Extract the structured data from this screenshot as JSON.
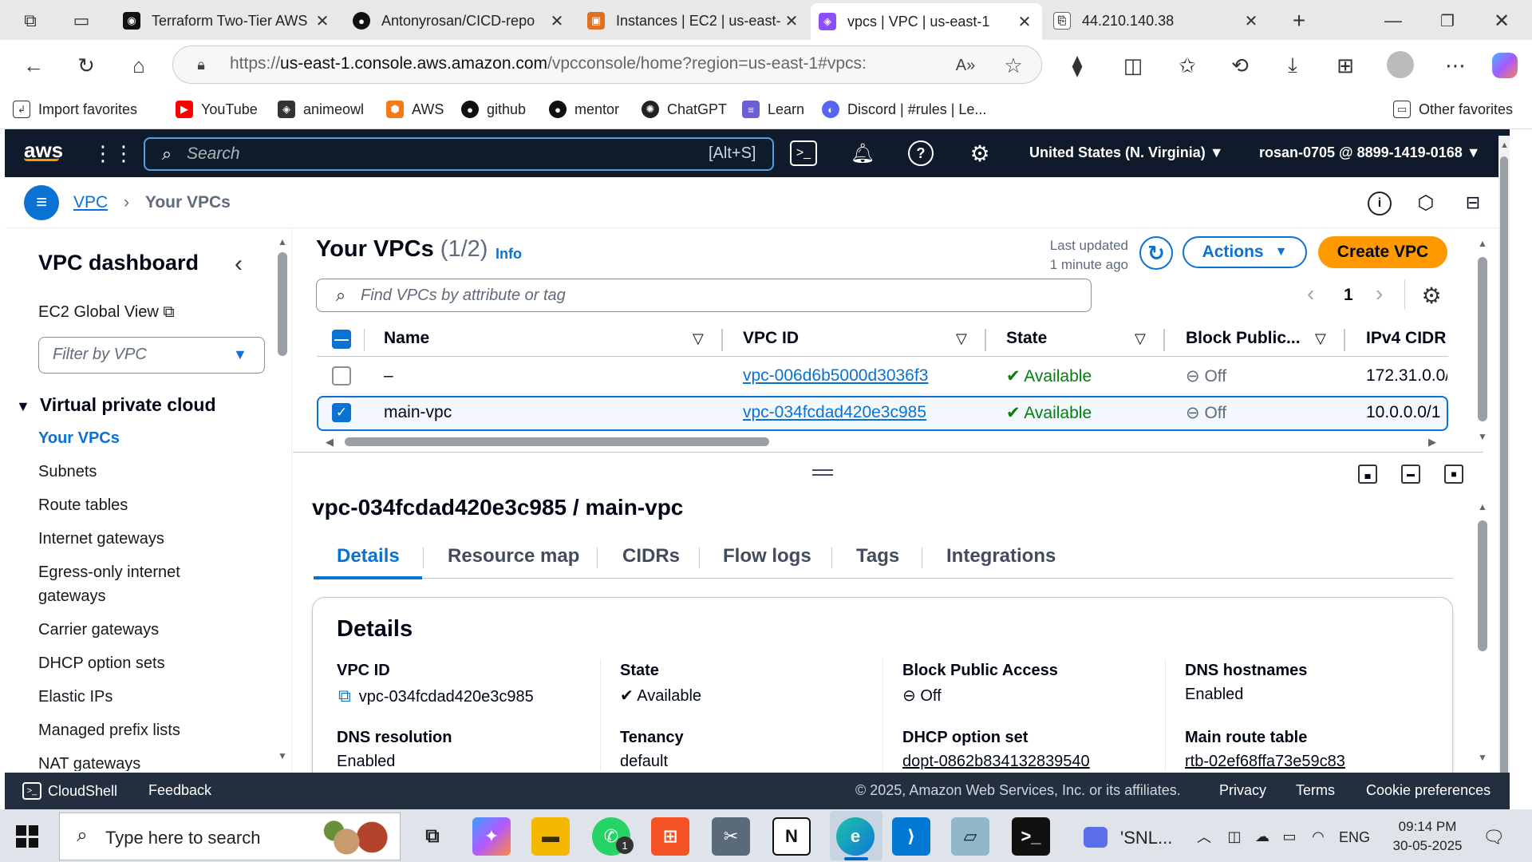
{
  "browser": {
    "tabs": [
      {
        "title": "Terraform Two-Tier AWS",
        "icon": "terraform-icon"
      },
      {
        "title": "Antonyrosan/CICD-repo",
        "icon": "github-icon"
      },
      {
        "title": "Instances | EC2 | us-east-",
        "icon": "ec2-icon"
      },
      {
        "title": "vpcs | VPC | us-east-1",
        "icon": "vpc-icon"
      },
      {
        "title": "44.210.140.38",
        "icon": "page-icon"
      }
    ],
    "url_prefix": "https://",
    "url_host": "us-east-1.console.aws.amazon.com",
    "url_path": "/vpcconsole/home?region=us-east-1#vpcs:",
    "bookmarks": [
      "Import favorites",
      "YouTube",
      "animeowl",
      "AWS",
      "github",
      "mentor",
      "ChatGPT",
      "Learn",
      "Discord | #rules | Le..."
    ],
    "other_favorites": "Other favorites"
  },
  "aws": {
    "search_placeholder": "Search",
    "search_shortcut": "[Alt+S]",
    "region": "United States (N. Virginia)",
    "account": "rosan-0705 @ 8899-1419-0168",
    "breadcrumb": [
      "VPC",
      "Your VPCs"
    ]
  },
  "sidebar": {
    "title": "VPC dashboard",
    "ec2_global_view": "EC2 Global View",
    "filter_placeholder": "Filter by VPC",
    "section": "Virtual private cloud",
    "items": [
      "Your VPCs",
      "Subnets",
      "Route tables",
      "Internet gateways",
      "Egress-only internet gateways",
      "Carrier gateways",
      "DHCP option sets",
      "Elastic IPs",
      "Managed prefix lists",
      "NAT gateways"
    ]
  },
  "list": {
    "title": "Your VPCs",
    "count": "(1/2)",
    "info": "Info",
    "last_updated_1": "Last updated",
    "last_updated_2": "1 minute ago",
    "actions_label": "Actions",
    "create_label": "Create VPC",
    "search_placeholder": "Find VPCs by attribute or tag",
    "page": "1",
    "columns": [
      "Name",
      "VPC ID",
      "State",
      "Block Public...",
      "IPv4 CIDR"
    ],
    "rows": [
      {
        "name": "–",
        "vpc_id": "vpc-006d6b5000d3036f3",
        "state": "Available",
        "block": "Off",
        "cidr": "172.31.0.0/",
        "selected": false
      },
      {
        "name": "main-vpc",
        "vpc_id": "vpc-034fcdad420e3c985",
        "state": "Available",
        "block": "Off",
        "cidr": "10.0.0.0/1",
        "selected": true
      }
    ]
  },
  "detail": {
    "heading": "vpc-034fcdad420e3c985 / main-vpc",
    "tabs": [
      "Details",
      "Resource map",
      "CIDRs",
      "Flow logs",
      "Tags",
      "Integrations"
    ],
    "active_tab": "Details",
    "panel_title": "Details",
    "fields": {
      "vpc_id_label": "VPC ID",
      "vpc_id": "vpc-034fcdad420e3c985",
      "state_label": "State",
      "state": "Available",
      "bpa_label": "Block Public Access",
      "bpa": "Off",
      "dns_hostnames_label": "DNS hostnames",
      "dns_hostnames": "Enabled",
      "dns_resolution_label": "DNS resolution",
      "dns_resolution": "Enabled",
      "tenancy_label": "Tenancy",
      "tenancy": "default",
      "dhcp_label": "DHCP option set",
      "dhcp": "dopt-0862b834132839540",
      "route_label": "Main route table",
      "route": "rtb-02ef68ffa73e59c83"
    }
  },
  "footer": {
    "cloudshell": "CloudShell",
    "feedback": "Feedback",
    "copyright": "© 2025, Amazon Web Services, Inc. or its affiliates.",
    "privacy": "Privacy",
    "terms": "Terms",
    "cookies": "Cookie preferences"
  },
  "taskbar": {
    "search_placeholder": "Type here to search",
    "media_label": "'SNL...",
    "language": "ENG",
    "time": "09:14 PM",
    "date": "30-05-2025",
    "whatsapp_badge": "1"
  },
  "colors": {
    "aws_nav": "#0f1b2a",
    "aws_orange": "#ff9900",
    "link_blue": "#0972d3",
    "available_green": "#037f0c",
    "footer": "#232f3e"
  }
}
